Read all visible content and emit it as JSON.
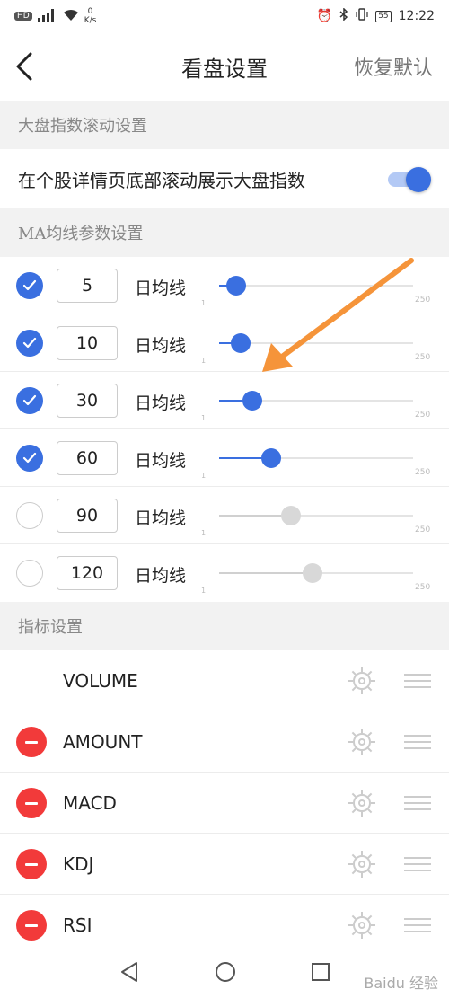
{
  "status": {
    "net_badge": "HD",
    "signal": "⁴⁶",
    "speed_value": "0",
    "speed_unit": "K/s",
    "battery": "55",
    "time": "12:22"
  },
  "header": {
    "title": "看盘设置",
    "reset_label": "恢复默认"
  },
  "market_section": {
    "title": "大盘指数滚动设置",
    "toggle_label": "在个股详情页底部滚动展示大盘指数",
    "toggle_on": true
  },
  "ma_section": {
    "title": "MA均线参数设置",
    "unit_label": "日均线",
    "min": "1",
    "max": "250",
    "rows": [
      {
        "period": "5",
        "checked": true,
        "slider_fraction": 0.09
      },
      {
        "period": "10",
        "checked": true,
        "slider_fraction": 0.11
      },
      {
        "period": "30",
        "checked": true,
        "slider_fraction": 0.17
      },
      {
        "period": "60",
        "checked": true,
        "slider_fraction": 0.27
      },
      {
        "period": "90",
        "checked": false,
        "slider_fraction": 0.37
      },
      {
        "period": "120",
        "checked": false,
        "slider_fraction": 0.48
      }
    ]
  },
  "indicator_section": {
    "title": "指标设置",
    "items": [
      {
        "name": "VOLUME",
        "removable": false
      },
      {
        "name": "AMOUNT",
        "removable": true
      },
      {
        "name": "MACD",
        "removable": true
      },
      {
        "name": "KDJ",
        "removable": true
      },
      {
        "name": "RSI",
        "removable": true
      }
    ]
  },
  "colors": {
    "accent": "#3a6fe0",
    "danger": "#f23a3a",
    "annotation_arrow": "#f5943a"
  },
  "watermark": "Baidu 经验"
}
